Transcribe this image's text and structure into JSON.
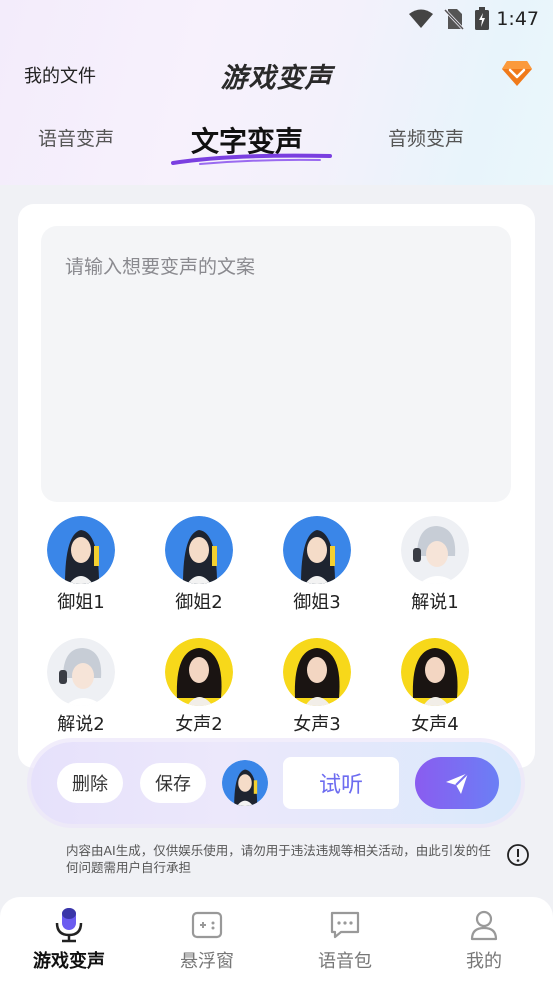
{
  "status_bar": {
    "time": "1:47"
  },
  "header": {
    "my_files": "我的文件",
    "title": "游戏变声"
  },
  "tabs": [
    {
      "label": "语音变声",
      "active": false
    },
    {
      "label": "文字变声",
      "active": true
    },
    {
      "label": "音频变声",
      "active": false
    }
  ],
  "input": {
    "placeholder": "请输入想要变声的文案",
    "value": ""
  },
  "voices": [
    {
      "name": "御姐1",
      "avatar": "blue-haired-woman"
    },
    {
      "name": "御姐2",
      "avatar": "blue-haired-woman"
    },
    {
      "name": "御姐3",
      "avatar": "blue-haired-woman"
    },
    {
      "name": "解说1",
      "avatar": "silver-haired-man"
    },
    {
      "name": "解说2",
      "avatar": "silver-haired-man"
    },
    {
      "name": "女声2",
      "avatar": "curly-haired-woman"
    },
    {
      "name": "女声3",
      "avatar": "curly-haired-woman"
    },
    {
      "name": "女声4",
      "avatar": "curly-haired-woman"
    }
  ],
  "action_bar": {
    "delete_label": "删除",
    "save_label": "保存",
    "try_label": "试听"
  },
  "disclaimer": "内容由AI生成，仅供娱乐使用，请勿用于违法违规等相关活动，由此引发的任何问题需用户自行承担",
  "bottom_nav": [
    {
      "label": "游戏变声",
      "icon": "microphone-icon",
      "active": true
    },
    {
      "label": "悬浮窗",
      "icon": "gamepad-window-icon",
      "active": false
    },
    {
      "label": "语音包",
      "icon": "chat-bubble-icon",
      "active": false
    },
    {
      "label": "我的",
      "icon": "person-icon",
      "active": false
    }
  ],
  "colors": {
    "accent": "#6d6cf0",
    "send_gradient_start": "#8a5cf0",
    "send_gradient_end": "#6b7ff5",
    "vip": "#f07a1a"
  }
}
